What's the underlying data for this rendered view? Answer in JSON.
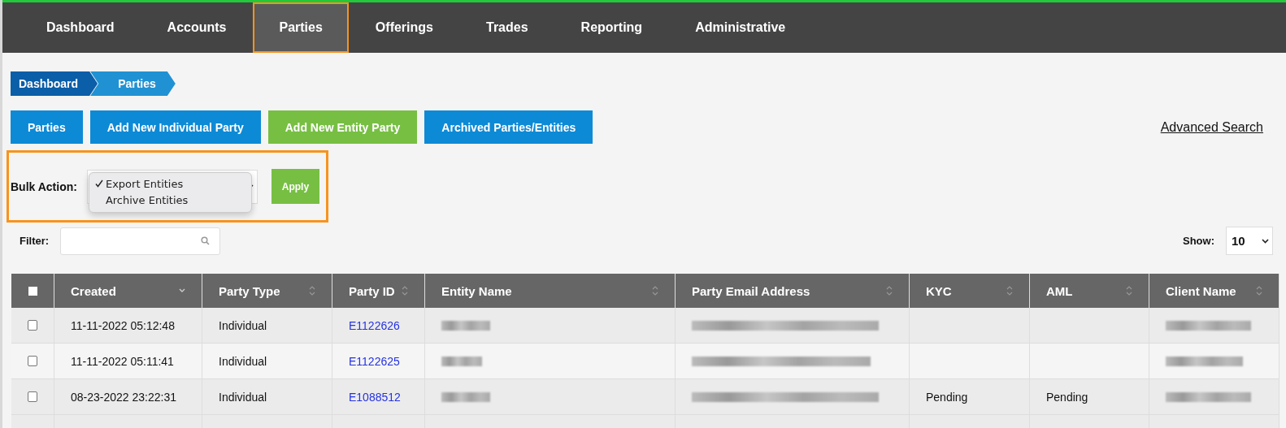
{
  "nav": [
    {
      "label": "Dashboard",
      "selected": false,
      "highlighted": false
    },
    {
      "label": "Accounts",
      "selected": false,
      "highlighted": false
    },
    {
      "label": "Parties",
      "selected": true,
      "highlighted": true
    },
    {
      "label": "Offerings",
      "selected": false,
      "highlighted": false
    },
    {
      "label": "Trades",
      "selected": false,
      "highlighted": false
    },
    {
      "label": "Reporting",
      "selected": false,
      "highlighted": false
    },
    {
      "label": "Administrative",
      "selected": false,
      "highlighted": false
    }
  ],
  "breadcrumb": [
    {
      "label": "Dashboard",
      "selected": false
    },
    {
      "label": "Parties",
      "selected": true
    }
  ],
  "actions": [
    {
      "label": "Parties",
      "kind": "primary"
    },
    {
      "label": "Add New Individual Party",
      "kind": "primary"
    },
    {
      "label": "Add New Entity Party",
      "kind": "success"
    },
    {
      "label": "Archived Parties/Entities",
      "kind": "primary"
    }
  ],
  "advanced_search": "Advanced Search",
  "bulk_action": {
    "label": "Bulk Action:",
    "highlighted": true,
    "expanded": true,
    "options": [
      {
        "label": "Export Entities",
        "selected": true
      },
      {
        "label": "Archive Entities",
        "selected": false
      }
    ],
    "apply": "Apply"
  },
  "filter": {
    "label": "Filter:"
  },
  "show": {
    "label": "Show:",
    "value": "10"
  },
  "table": {
    "select_all": {
      "checked": false
    },
    "columns": [
      {
        "label": "Created",
        "sorted": true
      },
      {
        "label": "Party Type",
        "sorted": false
      },
      {
        "label": "Party ID",
        "sorted": false
      },
      {
        "label": "Entity Name",
        "sorted": false
      },
      {
        "label": "Party Email Address",
        "sorted": false
      },
      {
        "label": "KYC",
        "sorted": false
      },
      {
        "label": "AML",
        "sorted": false
      },
      {
        "label": "Client Name",
        "sorted": false
      }
    ],
    "rows": [
      {
        "checked": false,
        "cells": [
          {
            "kind": "text",
            "text": "11-11-2022 05:12:48"
          },
          {
            "kind": "text",
            "text": "Individual"
          },
          {
            "kind": "link",
            "text": "E1122626"
          },
          {
            "kind": "redacted"
          },
          {
            "kind": "redacted"
          },
          {
            "kind": "empty"
          },
          {
            "kind": "empty"
          },
          {
            "kind": "redacted"
          }
        ]
      },
      {
        "checked": false,
        "cells": [
          {
            "kind": "text",
            "text": "11-11-2022 05:11:41"
          },
          {
            "kind": "text",
            "text": "Individual"
          },
          {
            "kind": "link",
            "text": "E1122625"
          },
          {
            "kind": "redacted"
          },
          {
            "kind": "redacted"
          },
          {
            "kind": "empty"
          },
          {
            "kind": "empty"
          },
          {
            "kind": "redacted"
          }
        ]
      },
      {
        "checked": false,
        "cells": [
          {
            "kind": "text",
            "text": "08-23-2022 23:22:31"
          },
          {
            "kind": "text",
            "text": "Individual"
          },
          {
            "kind": "link",
            "text": "E1088512"
          },
          {
            "kind": "redacted"
          },
          {
            "kind": "redacted"
          },
          {
            "kind": "text",
            "text": "Pending"
          },
          {
            "kind": "text",
            "text": "Pending"
          },
          {
            "kind": "redacted"
          }
        ]
      }
    ]
  }
}
